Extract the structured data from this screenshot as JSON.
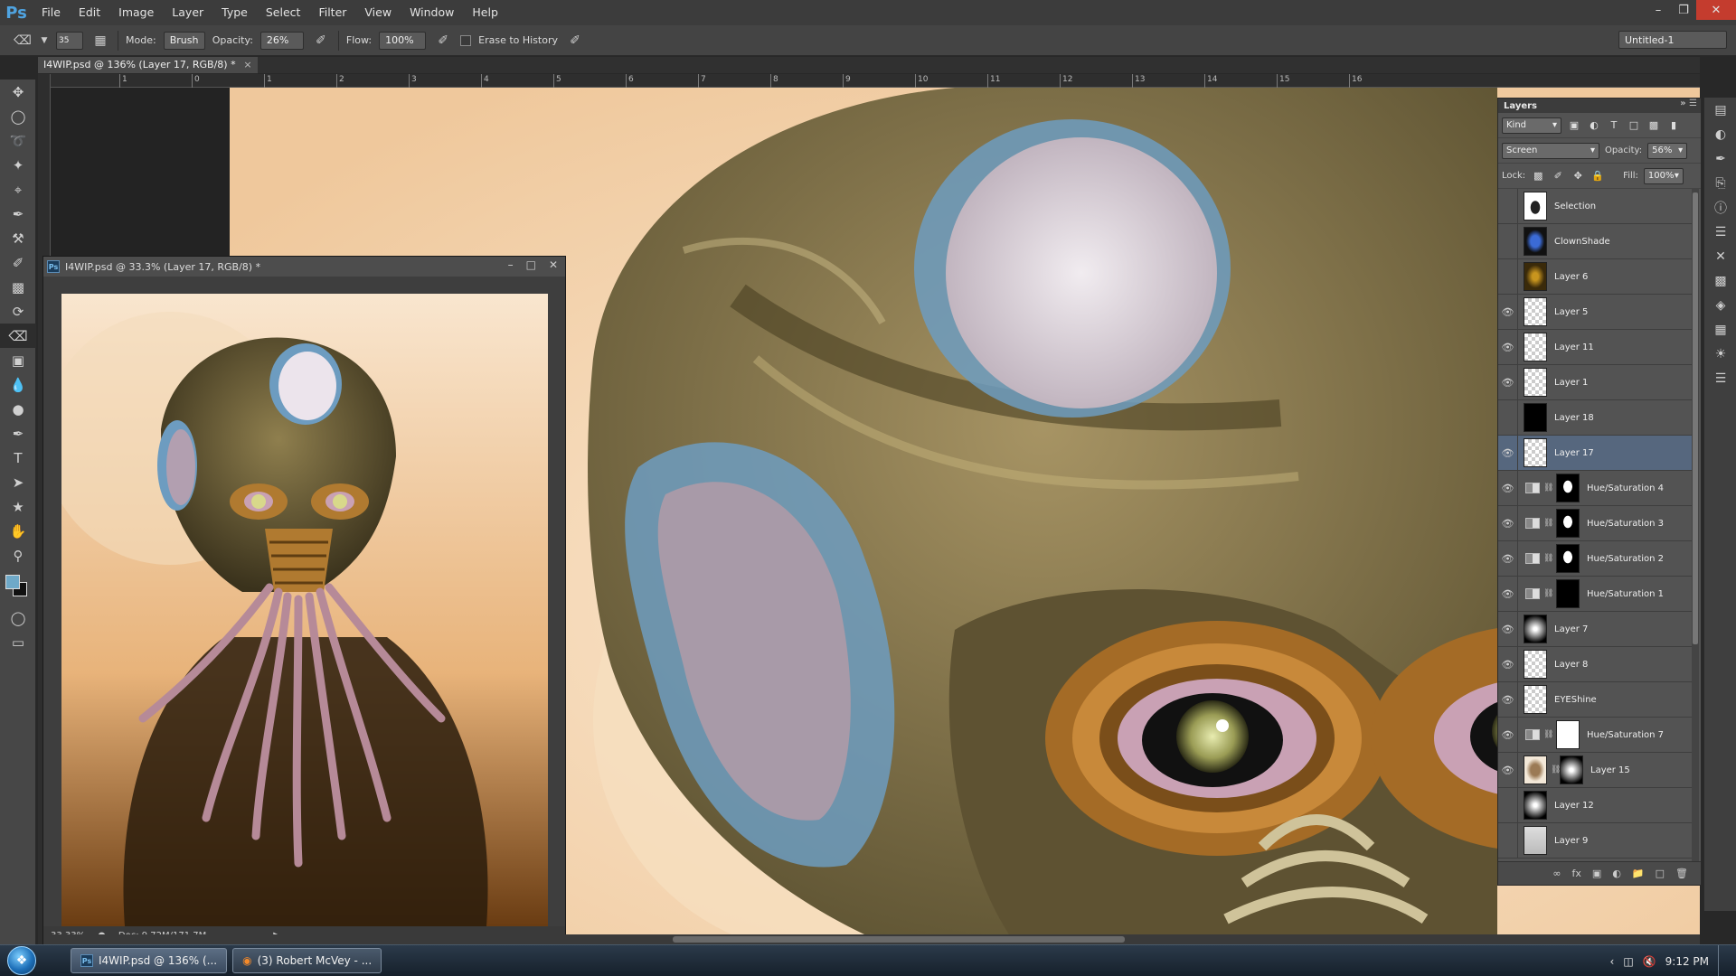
{
  "app": {
    "logo": "Ps",
    "menus": [
      "File",
      "Edit",
      "Image",
      "Layer",
      "Type",
      "Select",
      "Filter",
      "View",
      "Window",
      "Help"
    ]
  },
  "options_bar": {
    "brush_size": "35",
    "mode_label": "Mode:",
    "mode_value": "Brush",
    "opacity_label": "Opacity:",
    "opacity_value": "26%",
    "flow_label": "Flow:",
    "flow_value": "100%",
    "erase_to_history": "Erase to History",
    "workspace": "Untitled-1"
  },
  "document_tab": {
    "title": "I4WIP.psd @ 136% (Layer 17, RGB/8) *"
  },
  "ruler_numbers": [
    "1",
    "0",
    "1",
    "2",
    "3",
    "4",
    "5",
    "6",
    "7",
    "8",
    "9",
    "10",
    "11",
    "12",
    "13",
    "14",
    "15",
    "16"
  ],
  "floating_window": {
    "title": "I4WIP.psd @ 33.3% (Layer 17, RGB/8) *",
    "zoom": "33.33%",
    "doc_info": "Doc: 9.72M/171.7M"
  },
  "layers_panel": {
    "title": "Layers",
    "filter_kind": "Kind",
    "blend_mode": "Screen",
    "opacity_label": "Opacity:",
    "opacity_value": "56%",
    "lock_label": "Lock:",
    "fill_label": "Fill:",
    "fill_value": "100%",
    "layers": [
      {
        "name": "Selection",
        "visible": false,
        "thumb": "figure",
        "type": "pixel"
      },
      {
        "name": "ClownShade",
        "visible": false,
        "thumb": "blue",
        "type": "pixel"
      },
      {
        "name": "Layer 6",
        "visible": false,
        "thumb": "gold",
        "type": "pixel"
      },
      {
        "name": "Layer 5",
        "visible": true,
        "thumb": "check",
        "type": "pixel"
      },
      {
        "name": "Layer 11",
        "visible": true,
        "thumb": "check",
        "type": "pixel"
      },
      {
        "name": "Layer 1",
        "visible": true,
        "thumb": "check",
        "type": "pixel"
      },
      {
        "name": "Layer 18",
        "visible": false,
        "thumb": "black",
        "type": "pixel"
      },
      {
        "name": "Layer 17",
        "visible": true,
        "thumb": "check",
        "type": "pixel",
        "selected": true
      },
      {
        "name": "Hue/Saturation 4",
        "visible": true,
        "thumb": "figure-white",
        "type": "adjustment"
      },
      {
        "name": "Hue/Saturation 3",
        "visible": true,
        "thumb": "figure-white",
        "type": "adjustment"
      },
      {
        "name": "Hue/Saturation 2",
        "visible": true,
        "thumb": "figure-white",
        "type": "adjustment"
      },
      {
        "name": "Hue/Saturation 1",
        "visible": true,
        "thumb": "black",
        "type": "adjustment"
      },
      {
        "name": "Layer 7",
        "visible": true,
        "thumb": "grad",
        "type": "pixel"
      },
      {
        "name": "Layer 8",
        "visible": true,
        "thumb": "check",
        "type": "pixel"
      },
      {
        "name": "EYEShine",
        "visible": true,
        "thumb": "check",
        "type": "pixel"
      },
      {
        "name": "Hue/Saturation 7",
        "visible": true,
        "thumb": "white",
        "type": "adjustment"
      },
      {
        "name": "Layer 15",
        "visible": true,
        "thumb": "char",
        "type": "masked"
      },
      {
        "name": "Layer 12",
        "visible": false,
        "thumb": "grad",
        "type": "pixel"
      },
      {
        "name": "Layer 9",
        "visible": false,
        "thumb": "grey",
        "type": "pixel"
      }
    ]
  },
  "taskbar": {
    "items": [
      "I4WIP.psd @ 136% (...",
      "(3) Robert McVey - ..."
    ],
    "time": "9:12 PM"
  },
  "colors": {
    "foreground": "#6fa9c8",
    "background": "#111111",
    "selected_layer": "#56677e"
  }
}
